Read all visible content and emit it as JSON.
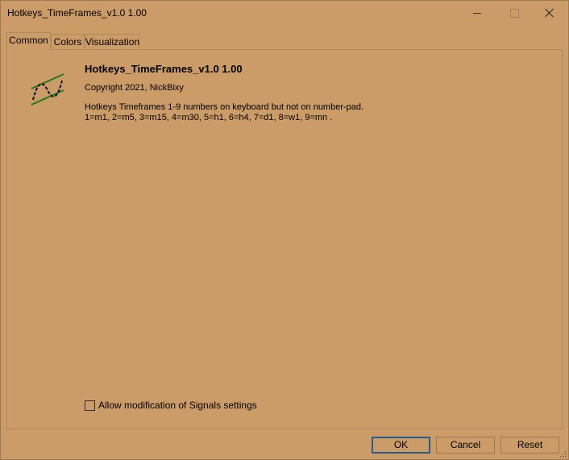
{
  "window": {
    "title": "Hotkeys_TimeFrames_v1.0 1.00"
  },
  "tabs": [
    {
      "label": "Common",
      "active": true
    },
    {
      "label": "Colors",
      "active": false
    },
    {
      "label": "Visualization",
      "active": false
    }
  ],
  "info": {
    "name": "Hotkeys_TimeFrames_v1.0 1.00",
    "copyright": "Copyright 2021, NickBixy",
    "description": "Hotkeys Timeframes 1-9 numbers on keyboard but not on number-pad.\n1=m1, 2=m5, 3=m15, 4=m30, 5=h1, 6=h4, 7=d1, 8=w1, 9=mn ."
  },
  "options": {
    "allow_modification_label": "Allow modification of Signals settings",
    "allow_modification_checked": false
  },
  "buttons": {
    "ok": "OK",
    "cancel": "Cancel",
    "reset": "Reset"
  },
  "colors": {
    "background": "#cb9b68",
    "logo_green": "#1e7a1e"
  },
  "icons": {
    "logo": "indicator-sine-wave-icon"
  }
}
